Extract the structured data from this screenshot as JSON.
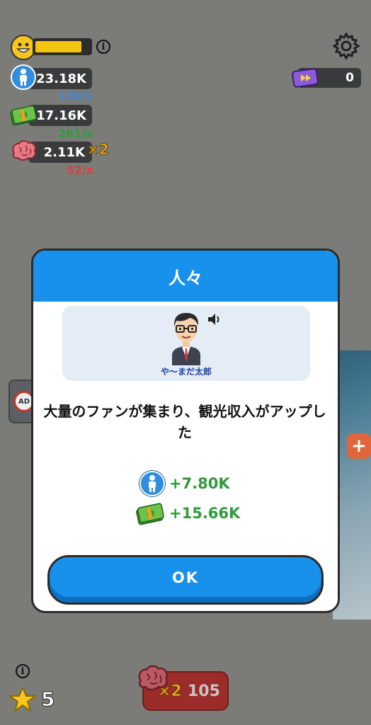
{
  "hud": {
    "people": {
      "value": "23.18K",
      "rate": "130/s"
    },
    "money": {
      "value": "17.16K",
      "rate": "261/s"
    },
    "brain": {
      "value": "2.11K",
      "multiplier": "×2",
      "rate": "52/s"
    },
    "mood_progress": 0.85,
    "info_glyph": "i",
    "ticket_count": "0"
  },
  "colors": {
    "people_rate": "#3f86cf",
    "money_rate": "#2f9b3a",
    "brain_rate": "#d94040",
    "multiplier": "#f2b51a"
  },
  "dialog": {
    "title": "人々",
    "speaker_name": "や～まだ太郎",
    "message": "大量のファンが集まり、観光収入がアップした",
    "rewards": [
      {
        "icon": "person-icon",
        "value": "+7.80K"
      },
      {
        "icon": "money-icon",
        "value": "+15.66K"
      }
    ],
    "ok_label": "OK"
  },
  "bottom": {
    "star_count": "5",
    "info_glyph": "i",
    "brain_button": {
      "multiplier": "×2",
      "cost": "105"
    }
  },
  "side": {
    "ad_label": "AD",
    "plus_label": "+"
  }
}
